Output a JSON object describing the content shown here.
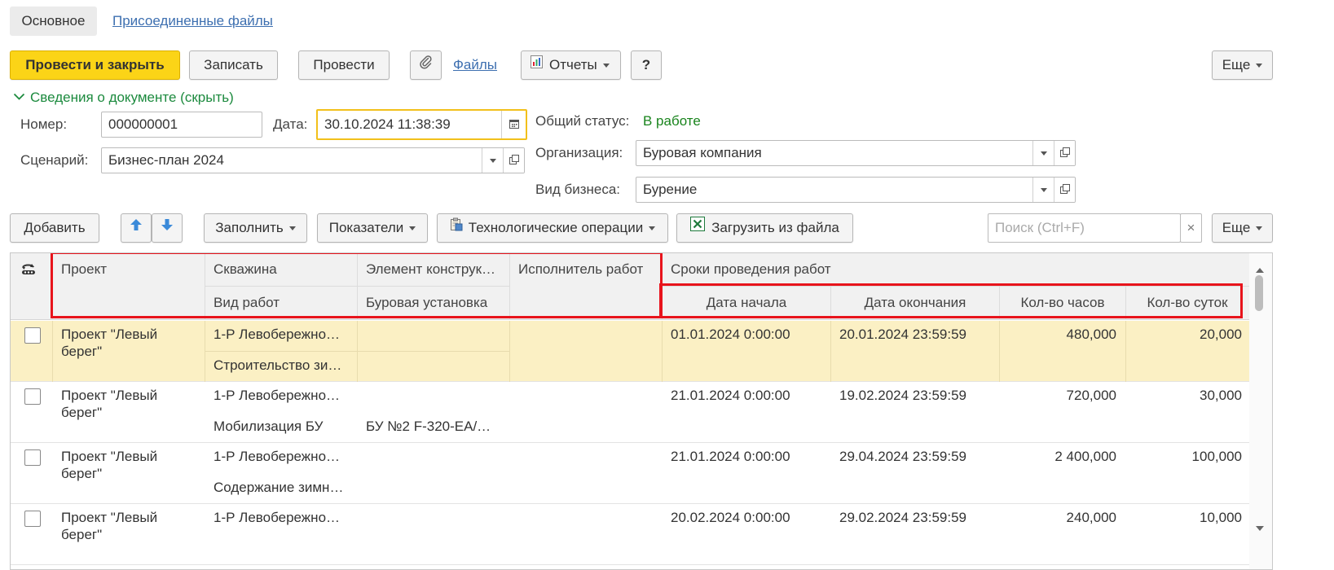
{
  "tabs": {
    "main": "Основное",
    "attached": "Присоединенные файлы"
  },
  "toolbar": {
    "post_close": "Провести и закрыть",
    "write": "Записать",
    "post": "Провести",
    "files": "Файлы",
    "reports": "Отчеты",
    "help": "?",
    "more": "Еще"
  },
  "doc": {
    "section_toggle": "Сведения о документе (скрыть)",
    "number_label": "Номер:",
    "number_value": "000000001",
    "date_label": "Дата:",
    "date_value": "30.10.2024 11:38:39",
    "status_label": "Общий статус:",
    "status_value": "В работе",
    "scenario_label": "Сценарий:",
    "scenario_value": "Бизнес-план 2024",
    "org_label": "Организация:",
    "org_value": "Буровая компания",
    "business_label": "Вид бизнеса:",
    "business_value": "Бурение"
  },
  "table_toolbar": {
    "add": "Добавить",
    "fill": "Заполнить",
    "indicators": "Показатели",
    "tech_ops": "Технологические операции",
    "load_file": "Загрузить из файла",
    "search_placeholder": "Поиск (Ctrl+F)",
    "clear": "×",
    "more": "Еще"
  },
  "columns": {
    "project": "Проект",
    "well": "Скважина",
    "work_type": "Вид работ",
    "element": "Элемент конструк…",
    "rig": "Буровая установка",
    "contractor": "Исполнитель работ",
    "period": "Сроки проведения работ",
    "start": "Дата начала",
    "end": "Дата окончания",
    "hours": "Кол-во часов",
    "days": "Кол-во суток"
  },
  "rows": [
    {
      "project1": "Проект \"Левый",
      "project2": "берег\"",
      "well": "1-Р Левобережно…",
      "work": "Строительство зи…",
      "element": "",
      "rig": "",
      "contractor": "",
      "start": "01.01.2024 0:00:00",
      "end": "20.01.2024 23:59:59",
      "hours": "480,000",
      "days": "20,000",
      "selected": true
    },
    {
      "project1": "Проект \"Левый",
      "project2": "берег\"",
      "well": "1-Р Левобережно…",
      "work": "Мобилизация БУ",
      "element": "",
      "rig": "БУ №2 F-320-EA/…",
      "contractor": "",
      "start": "21.01.2024 0:00:00",
      "end": "19.02.2024 23:59:59",
      "hours": "720,000",
      "days": "30,000",
      "selected": false
    },
    {
      "project1": "Проект \"Левый",
      "project2": "берег\"",
      "well": "1-Р Левобережно…",
      "work": "Содержание зимн…",
      "element": "",
      "rig": "",
      "contractor": "",
      "start": "21.01.2024 0:00:00",
      "end": "29.04.2024 23:59:59",
      "hours": "2 400,000",
      "days": "100,000",
      "selected": false
    },
    {
      "project1": "Проект \"Левый",
      "project2": "берег\"",
      "well": "1-Р Левобережно…",
      "work": "",
      "element": "",
      "rig": "",
      "contractor": "",
      "start": "20.02.2024 0:00:00",
      "end": "29.02.2024 23:59:59",
      "hours": "240,000",
      "days": "10,000",
      "selected": false
    }
  ],
  "colors": {
    "primary": "#fbd417",
    "status": "#19841d",
    "link": "#3d6fb0",
    "highlight": "#e8141c",
    "selected_row": "#fbf0c4"
  }
}
